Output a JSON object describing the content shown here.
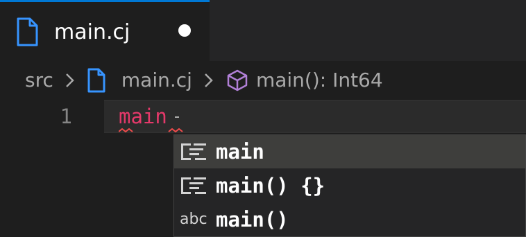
{
  "tab": {
    "label": "main.cj",
    "file_icon": "file-icon",
    "dirty_indicator": "dot-icon",
    "accent_color": "#0078d4"
  },
  "breadcrumb": {
    "folder": "src",
    "file": "main.cj",
    "symbol": "main(): Int64",
    "file_icon_color": "#3794ff",
    "symbol_icon": "cube-icon",
    "symbol_icon_color": "#b180d7"
  },
  "editor": {
    "line_number": "1",
    "code": "main",
    "code_color": "#e5396a",
    "error_squiggle_color": "#f14c4c"
  },
  "suggestions": {
    "items": [
      {
        "label": "main",
        "icon": "snippet-icon",
        "selected": true
      },
      {
        "label": "main() {}",
        "icon": "snippet-icon",
        "selected": false
      },
      {
        "label": "main()",
        "icon": "abc-icon",
        "icon_text": "abc",
        "selected": false
      }
    ]
  }
}
